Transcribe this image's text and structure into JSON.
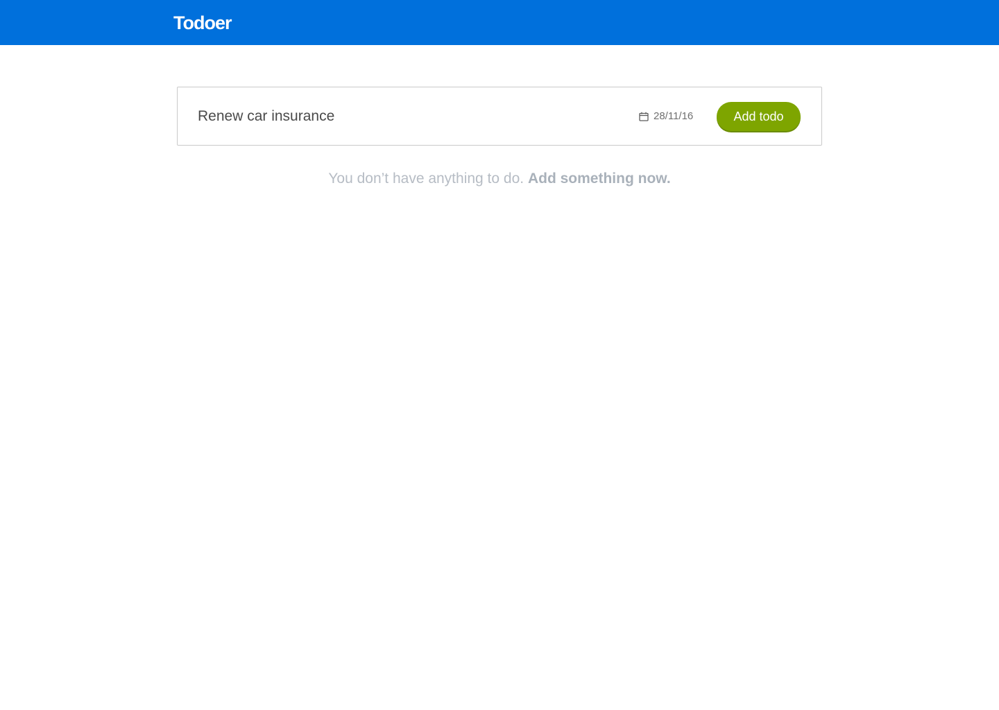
{
  "header": {
    "logo_text": "Todoer",
    "background_color": "#0070dc"
  },
  "form": {
    "todo_input_value": "Renew car insurance",
    "date_icon": "calendar-icon",
    "date_value": "28/11/16",
    "add_button_label": "Add todo",
    "add_button_color": "#7ea500"
  },
  "empty_state": {
    "message": "You don’t have anything to do.",
    "link_text": "Add something now."
  }
}
